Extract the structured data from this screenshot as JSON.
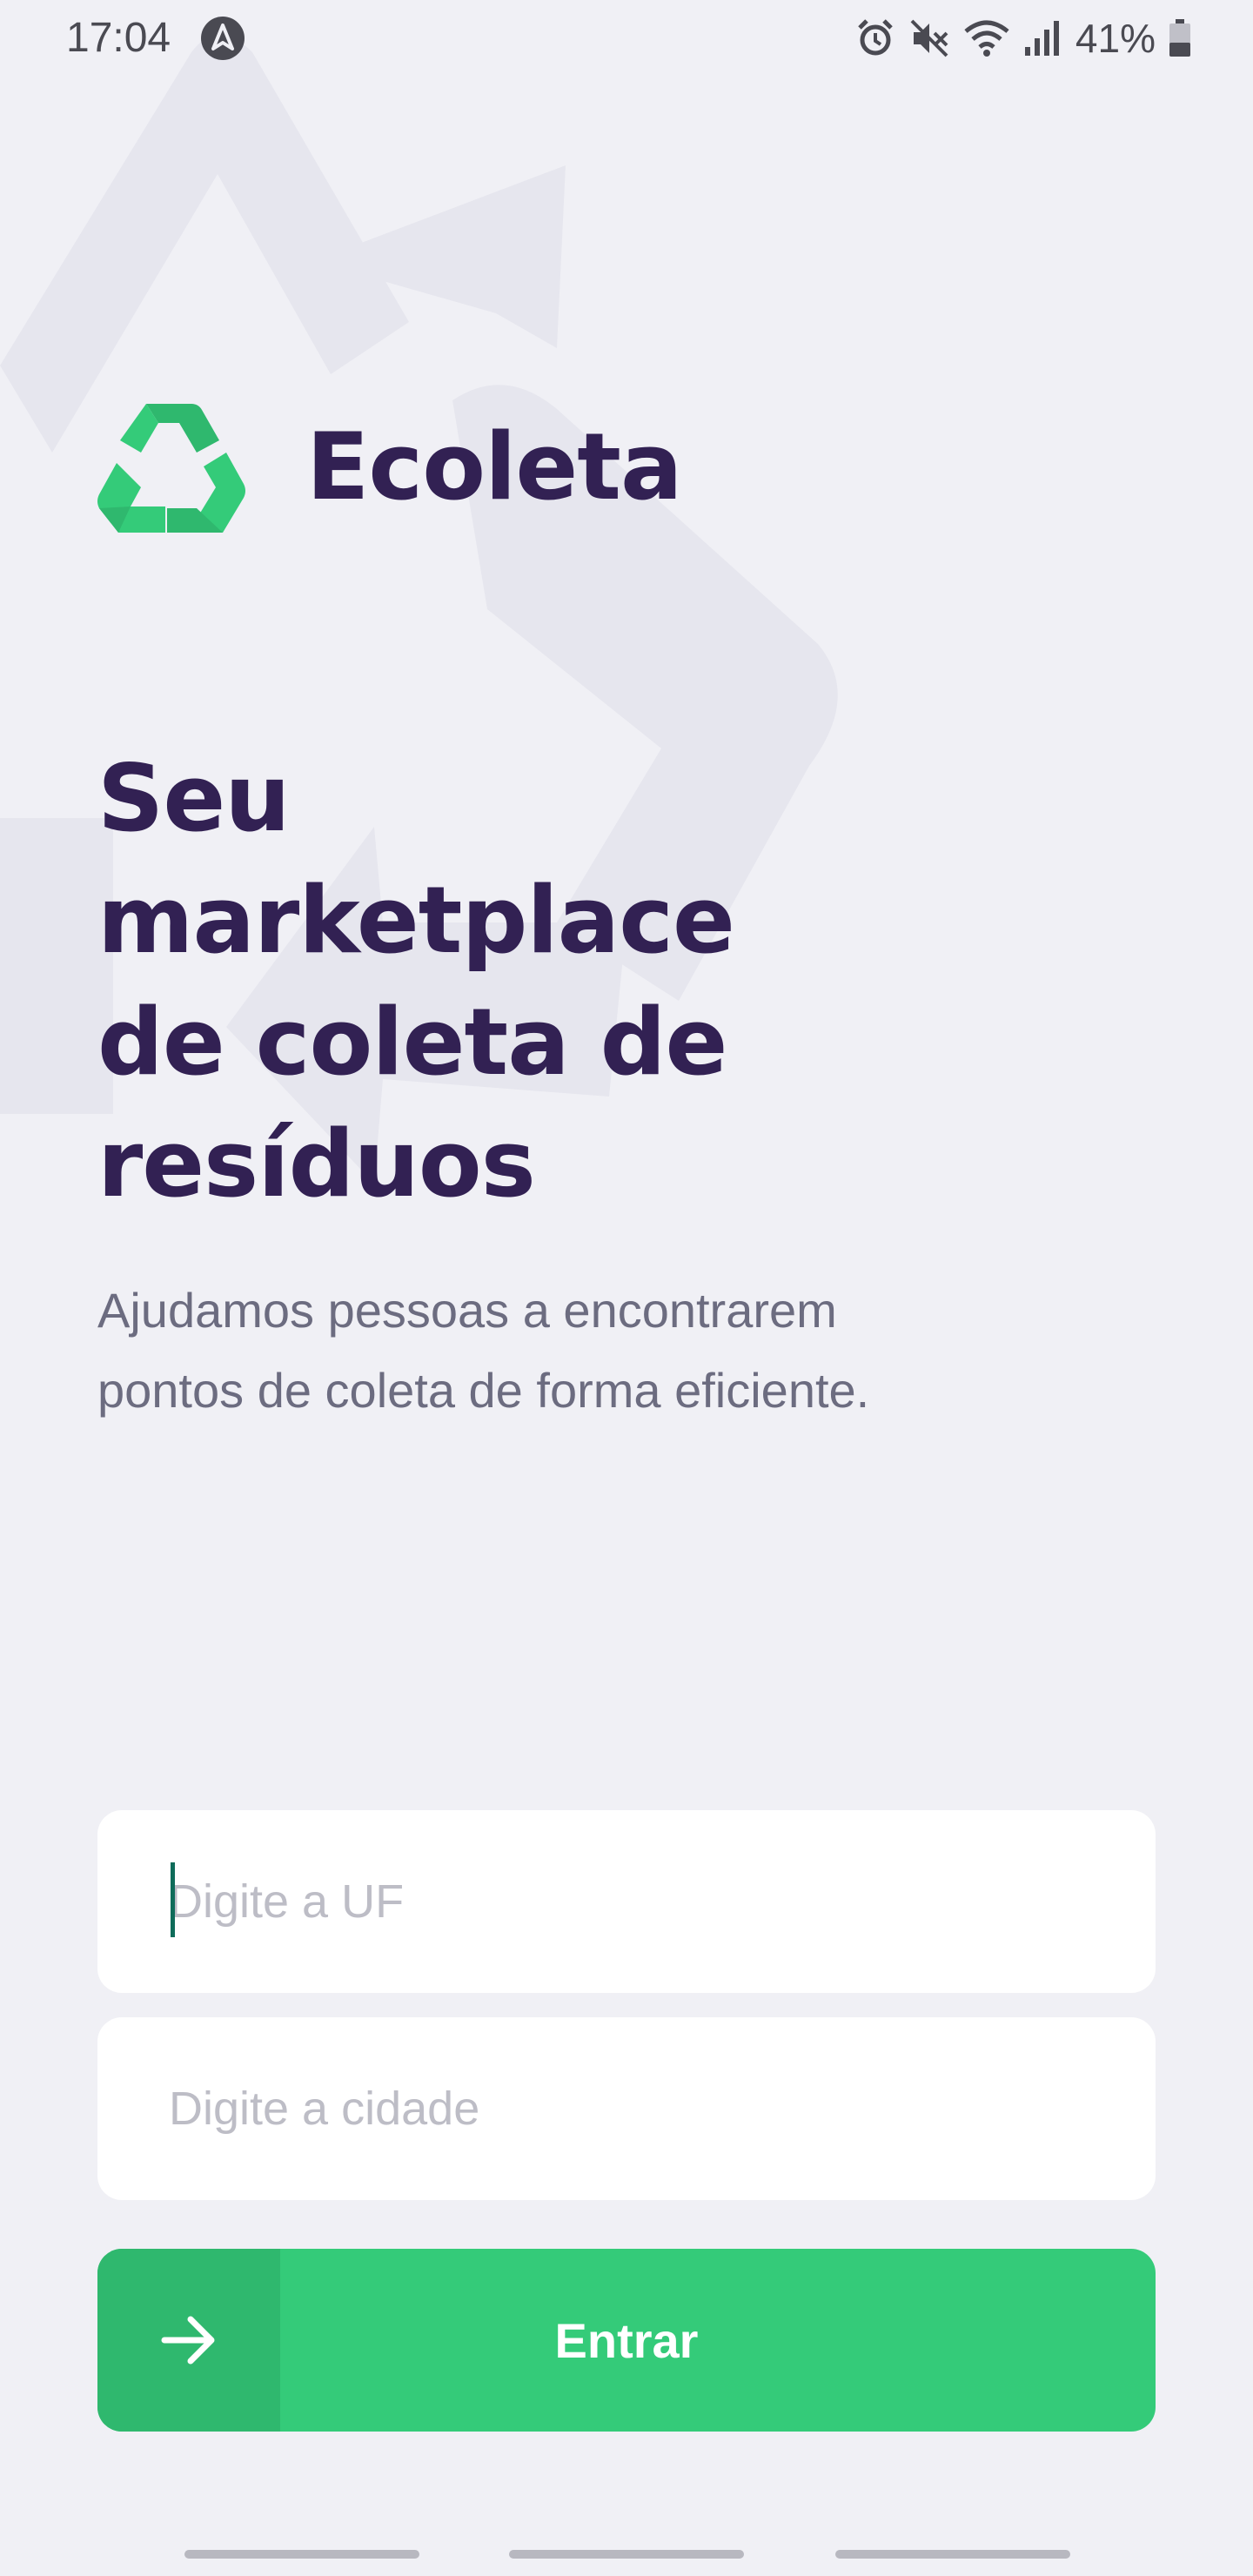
{
  "status_bar": {
    "time": "17:04",
    "battery_percent": "41%",
    "battery_level": 0.41,
    "icons": [
      "navigation-badge-icon",
      "alarm-icon",
      "vibrate-mute-icon",
      "wifi-icon",
      "signal-icon",
      "battery-icon"
    ]
  },
  "brand": {
    "name": "Ecoleta",
    "logo_icon": "recycle-icon"
  },
  "hero": {
    "title": "Seu marketplace de coleta de resíduos",
    "description": "Ajudamos pessoas a encontrarem pontos de coleta de forma eficiente."
  },
  "form": {
    "uf": {
      "value": "",
      "placeholder": "Digite a UF"
    },
    "city": {
      "value": "",
      "placeholder": "Digite a cidade"
    },
    "submit": {
      "label": "Entrar",
      "icon": "arrow-right-icon"
    }
  },
  "colors": {
    "background": "#f0f0f5",
    "brand_dark": "#322153",
    "text_muted": "#6c6c80",
    "accent_green": "#34cb79",
    "accent_green_dark": "#2fb86e",
    "field_bg": "#ffffff"
  },
  "nav_bar": {
    "icons": [
      "recent-apps-icon",
      "home-icon",
      "back-icon"
    ]
  }
}
